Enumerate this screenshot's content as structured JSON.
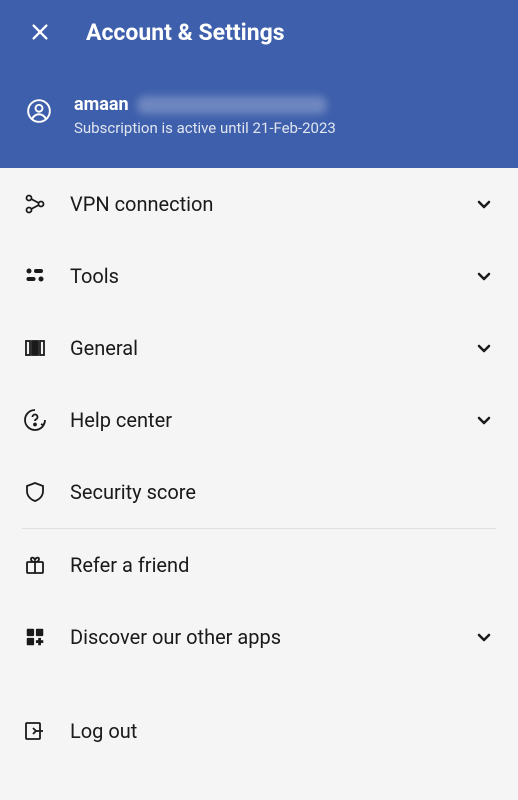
{
  "header": {
    "title": "Account & Settings"
  },
  "user": {
    "name": "amaan",
    "subscription": "Subscription is active until 21-Feb-2023"
  },
  "menu": {
    "vpn": "VPN connection",
    "tools": "Tools",
    "general": "General",
    "help": "Help center",
    "security": "Security score",
    "refer": "Refer a friend",
    "discover": "Discover our other apps",
    "logout": "Log out"
  }
}
